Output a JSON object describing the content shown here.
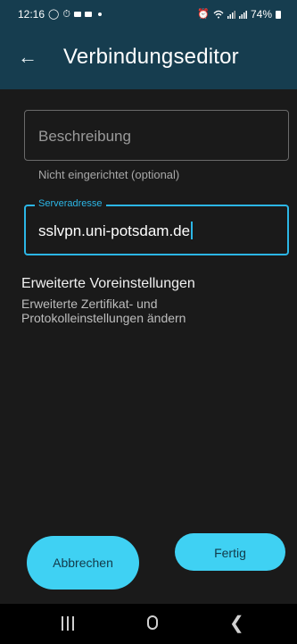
{
  "status_bar": {
    "time": "12:16",
    "battery": "74%",
    "icons": [
      "whatsapp-icon",
      "timer-icon",
      "message-icon",
      "message-icon",
      "dot-icon",
      "alarm-icon",
      "wifi-icon",
      "signal-icon",
      "signal-icon",
      "battery-icon"
    ]
  },
  "app_bar": {
    "title": "Verbindungseditor",
    "back_icon": "arrow-left-icon"
  },
  "form": {
    "description": {
      "placeholder": "Beschreibung",
      "helper": "Nicht eingerichtet (optional)"
    },
    "server": {
      "label": "Serveradresse",
      "value": "sslvpn.uni-potsdam.de"
    }
  },
  "advanced": {
    "title": "Erweiterte Voreinstellungen",
    "subtitle": "Erweiterte Zertifikat- und Protokolleinstellungen ändern"
  },
  "buttons": {
    "cancel": "Abbrechen",
    "done": "Fertig"
  },
  "nav_bar": {
    "icons": [
      "recents-icon",
      "home-icon",
      "back-icon"
    ]
  },
  "colors": {
    "app_bar": "#163d4f",
    "accent": "#2cb6e6",
    "button": "#3fd1f3",
    "background": "#1a1a1a"
  }
}
